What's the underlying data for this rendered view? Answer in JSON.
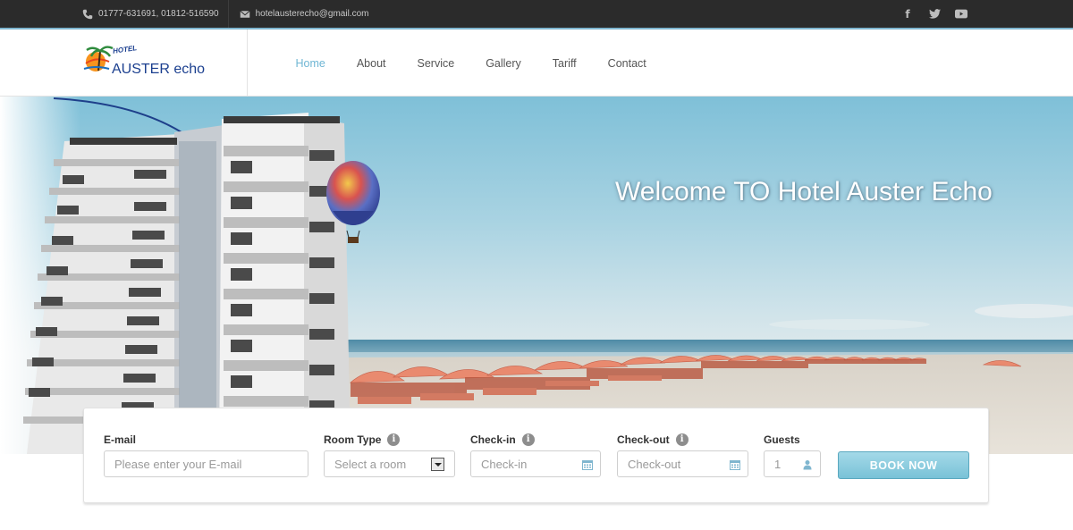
{
  "topbar": {
    "phone": "01777-631691, 01812-516590",
    "email": "hotelausterecho@gmail.com",
    "social": [
      {
        "icon": "facebook-icon",
        "glyph": "f"
      },
      {
        "icon": "twitter-icon",
        "glyph": "t"
      },
      {
        "icon": "youtube-icon",
        "glyph": "▶"
      }
    ]
  },
  "logo": {
    "hotel": "HOTEL",
    "name": "AUSTER echo"
  },
  "nav": {
    "items": [
      "Home",
      "About",
      "Service",
      "Gallery",
      "Tariff",
      "Contact"
    ],
    "active": "Home"
  },
  "hero": {
    "title": "Welcome TO Hotel Auster Echo"
  },
  "booking": {
    "email": {
      "label": "E-mail",
      "placeholder": "Please enter your E-mail"
    },
    "room_type": {
      "label": "Room Type",
      "selected": "Select a room"
    },
    "checkin": {
      "label": "Check-in",
      "placeholder": "Check-in"
    },
    "checkout": {
      "label": "Check-out",
      "placeholder": "Check-out"
    },
    "guests": {
      "label": "Guests",
      "value": "1"
    },
    "button": "BOOK NOW"
  },
  "colors": {
    "accent": "#6fb6d4",
    "topbar": "#2b2b2b",
    "button": "#79c2d7",
    "logo": "#1b3f8f"
  }
}
